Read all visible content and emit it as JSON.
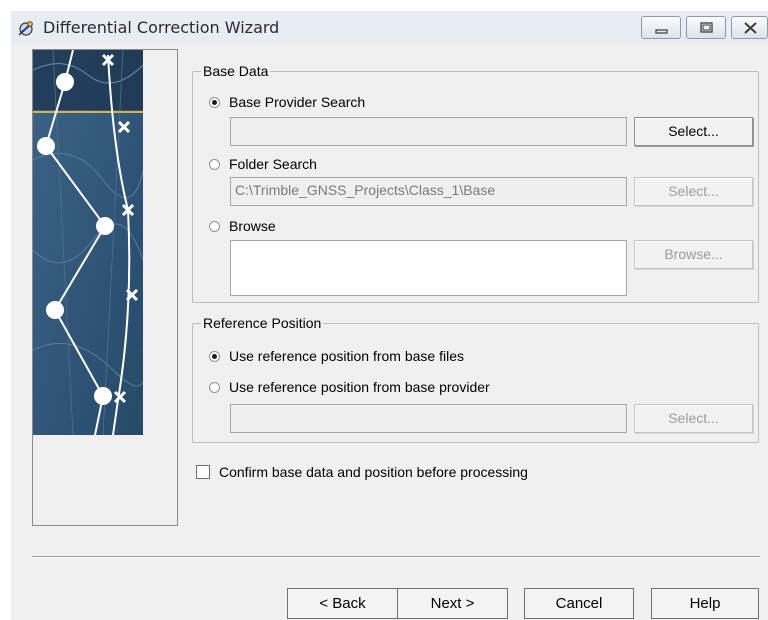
{
  "window": {
    "title": "Differential Correction Wizard",
    "buttons": [
      "minimize",
      "restore",
      "close"
    ]
  },
  "base_data": {
    "legend": "Base Data",
    "base_provider_search": {
      "label": "Base Provider Search",
      "selected": true,
      "value": "",
      "button": "Select..."
    },
    "folder_search": {
      "label": "Folder Search",
      "selected": false,
      "value": "C:\\Trimble_GNSS_Projects\\Class_1\\Base",
      "button": "Select..."
    },
    "browse": {
      "label": "Browse",
      "selected": false,
      "value": "",
      "button": "Browse..."
    }
  },
  "reference_position": {
    "legend": "Reference Position",
    "from_base_files": {
      "label": "Use reference position from base files",
      "selected": true
    },
    "from_base_provider": {
      "label": "Use reference position from base provider",
      "selected": false,
      "value": "",
      "button": "Select..."
    }
  },
  "confirm": {
    "label": "Confirm base data and position before processing",
    "checked": false
  },
  "footer": {
    "back": "< Back",
    "next": "Next >",
    "cancel": "Cancel",
    "help": "Help"
  },
  "colors": {
    "titlebar": "#e8edf3",
    "dialog_bg": "#f0f0f0",
    "art_blue": "#2f5577",
    "art_gold": "#d6b24a"
  }
}
